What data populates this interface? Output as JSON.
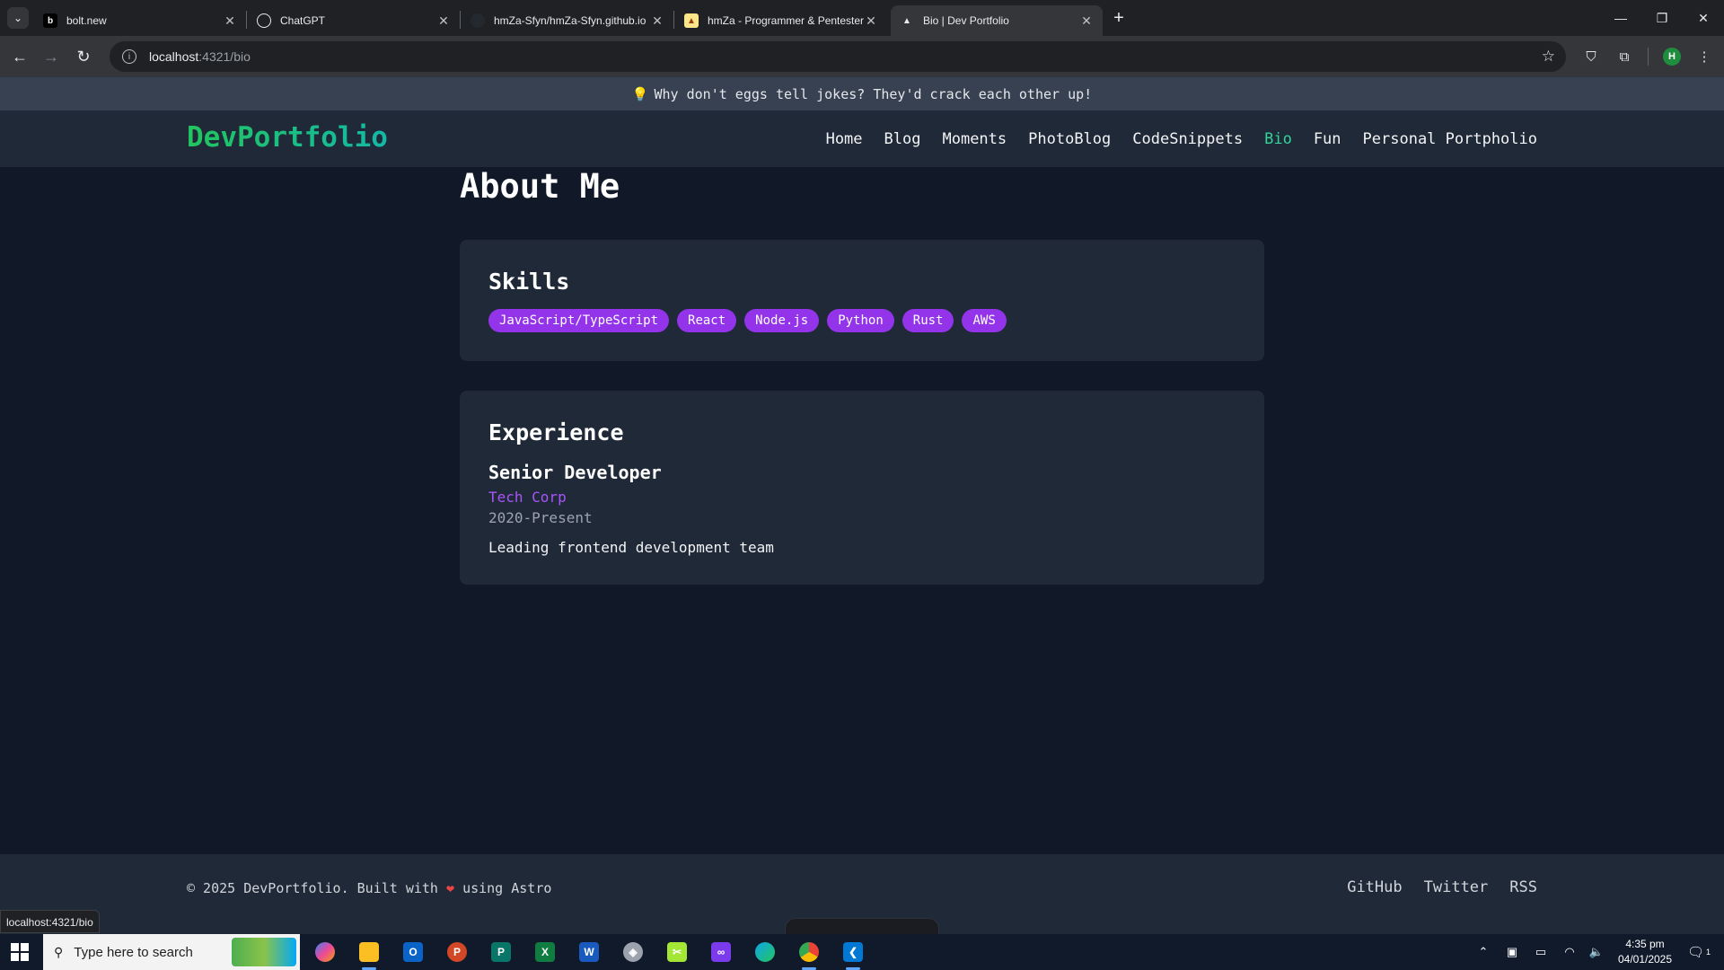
{
  "browser": {
    "tabs": [
      {
        "title": "bolt.new",
        "icon": "bolt-icon",
        "active": false
      },
      {
        "title": "ChatGPT",
        "icon": "chatgpt-icon",
        "active": false
      },
      {
        "title": "hmZa-Sfyn/hmZa-Sfyn.github.io",
        "icon": "github-icon",
        "active": false
      },
      {
        "title": "hmZa - Programmer & Pentester",
        "icon": "site-icon",
        "active": false
      },
      {
        "title": "Bio | Dev Portfolio",
        "icon": "astro-icon",
        "active": true
      }
    ],
    "url_host": "localhost",
    "url_path": ":4321/bio",
    "profile_initial": "H",
    "status_url": "localhost:4321/bio"
  },
  "site": {
    "joke": "Why don't eggs tell jokes? They'd crack each other up!",
    "logo": "DevPortfolio",
    "nav": [
      {
        "label": "Home",
        "active": false
      },
      {
        "label": "Blog",
        "active": false
      },
      {
        "label": "Moments",
        "active": false
      },
      {
        "label": "PhotoBlog",
        "active": false
      },
      {
        "label": "CodeSnippets",
        "active": false
      },
      {
        "label": "Bio",
        "active": true
      },
      {
        "label": "Fun",
        "active": false
      },
      {
        "label": "Personal Portpholio",
        "active": false
      }
    ],
    "accent_color": "#34d399",
    "badge_color": "#9333ea"
  },
  "main": {
    "title": "About Me",
    "skills": {
      "heading": "Skills",
      "items": [
        "JavaScript/TypeScript",
        "React",
        "Node.js",
        "Python",
        "Rust",
        "AWS"
      ]
    },
    "experience": {
      "heading": "Experience",
      "role": "Senior Developer",
      "company": "Tech Corp",
      "period": "2020-Present",
      "description": "Leading frontend development team"
    }
  },
  "footer": {
    "copyright_prefix": "© 2025 DevPortfolio. Built with",
    "copyright_suffix": "using Astro",
    "links": [
      "GitHub",
      "Twitter",
      "RSS"
    ]
  },
  "taskbar": {
    "search_placeholder": "Type here to search",
    "time": "4:35 pm",
    "date": "04/01/2025",
    "notification_count": "1"
  }
}
